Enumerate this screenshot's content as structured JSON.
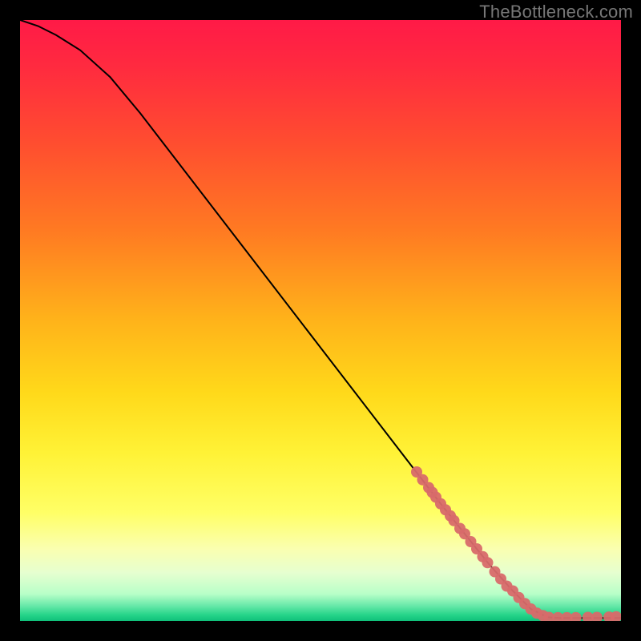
{
  "watermark": "TheBottleneck.com",
  "colors": {
    "background": "#000000",
    "curve": "#000000",
    "marker": "#d86a6a",
    "gradient_stops": [
      {
        "offset": 0.0,
        "color": "#ff1a47"
      },
      {
        "offset": 0.08,
        "color": "#ff2b3f"
      },
      {
        "offset": 0.2,
        "color": "#ff4c30"
      },
      {
        "offset": 0.35,
        "color": "#ff7a22"
      },
      {
        "offset": 0.5,
        "color": "#ffb31a"
      },
      {
        "offset": 0.62,
        "color": "#ffd91a"
      },
      {
        "offset": 0.72,
        "color": "#fff236"
      },
      {
        "offset": 0.82,
        "color": "#ffff66"
      },
      {
        "offset": 0.88,
        "color": "#faffb0"
      },
      {
        "offset": 0.92,
        "color": "#e6ffd0"
      },
      {
        "offset": 0.955,
        "color": "#b8ffc8"
      },
      {
        "offset": 0.975,
        "color": "#66e8a8"
      },
      {
        "offset": 0.99,
        "color": "#26d489"
      },
      {
        "offset": 1.0,
        "color": "#0fc07a"
      }
    ]
  },
  "chart_data": {
    "type": "line",
    "title": "",
    "xlabel": "",
    "ylabel": "",
    "xlim": [
      0,
      100
    ],
    "ylim": [
      0,
      100
    ],
    "grid": false,
    "legend": false,
    "series": [
      {
        "name": "bottleneck-curve",
        "x": [
          0,
          3,
          6,
          10,
          15,
          20,
          25,
          30,
          35,
          40,
          45,
          50,
          55,
          60,
          65,
          70,
          74,
          78,
          82,
          85,
          87,
          88,
          90,
          92,
          94,
          96,
          98,
          100
        ],
        "y": [
          100,
          99,
          97.5,
          95,
          90.5,
          84.5,
          78,
          71.5,
          65,
          58.5,
          52,
          45.5,
          39,
          32.5,
          26,
          19.5,
          14.5,
          9.5,
          5,
          2,
          1,
          0.6,
          0.5,
          0.5,
          0.5,
          0.5,
          0.5,
          0.5
        ]
      }
    ],
    "marker_cluster": {
      "name": "highlighted-range",
      "note": "thick salmon overlay along lower-right portion of curve",
      "points_xy": [
        [
          66,
          24.8
        ],
        [
          67,
          23.5
        ],
        [
          68,
          22.2
        ],
        [
          68.6,
          21.4
        ],
        [
          69.2,
          20.6
        ],
        [
          70,
          19.5
        ],
        [
          70.8,
          18.5
        ],
        [
          71.6,
          17.5
        ],
        [
          72.2,
          16.7
        ],
        [
          73.2,
          15.4
        ],
        [
          74,
          14.5
        ],
        [
          75,
          13.2
        ],
        [
          76,
          12.0
        ],
        [
          77,
          10.7
        ],
        [
          77.8,
          9.7
        ],
        [
          79,
          8.2
        ],
        [
          80,
          7.0
        ],
        [
          81,
          5.8
        ],
        [
          82,
          5.0
        ],
        [
          83,
          3.9
        ],
        [
          84,
          2.9
        ],
        [
          85,
          2.0
        ],
        [
          86,
          1.3
        ],
        [
          87,
          0.9
        ],
        [
          88,
          0.6
        ],
        [
          89.5,
          0.55
        ],
        [
          91,
          0.55
        ],
        [
          92.5,
          0.55
        ],
        [
          94.5,
          0.6
        ],
        [
          96,
          0.6
        ],
        [
          98,
          0.65
        ],
        [
          99.2,
          0.7
        ]
      ]
    }
  }
}
